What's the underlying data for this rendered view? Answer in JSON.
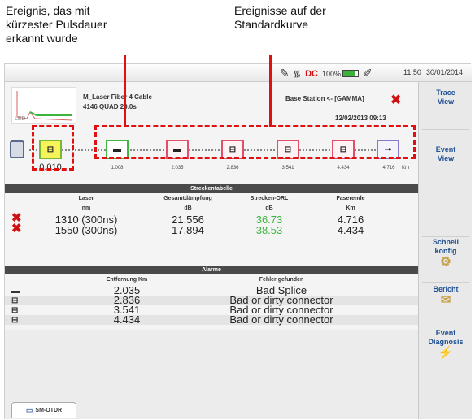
{
  "annotations": {
    "left": [
      "Ereignis, das mit",
      "kürzester Pulsdauer",
      "erkannt wurde"
    ],
    "right": [
      "Ereignisse auf der",
      "Standardkurve"
    ]
  },
  "statusbar": {
    "battery": "100%",
    "dc": "DC",
    "time": "11:50",
    "date": "30/01/2014"
  },
  "header": {
    "file_line": "M_Laser    Fiber 4  Cable",
    "sub_line": "4146 QUAD    20.0s",
    "base_station": "Base Station <- [GAMMA]",
    "date_line": "12/02/2013   09:13",
    "thumb_label": "LED"
  },
  "events": {
    "first_distance": "0.010",
    "distances": [
      "1.008",
      "2.035",
      "2.836",
      "3.541",
      "4.434",
      "4.716"
    ],
    "km_unit": "Km"
  },
  "summary_table": {
    "title": "Streckentabelle",
    "columns": [
      "Laser",
      "Gesamtdämpfung",
      "Strecken-ORL",
      "Faserende"
    ],
    "units": [
      "nm",
      "dB",
      "dB",
      "Km"
    ],
    "rows": [
      {
        "laser": "1310 (300ns)",
        "loss": "21.556",
        "orl": "36.73",
        "end": "4.716"
      },
      {
        "laser": "1550 (300ns)",
        "loss": "17.894",
        "orl": "38.53",
        "end": "4.434"
      }
    ]
  },
  "alarm_table": {
    "title": "Alarme",
    "columns": [
      "Entfernung Km",
      "Fehler gefunden"
    ],
    "rows": [
      {
        "distance": "2.035",
        "fault": "Bad Splice"
      },
      {
        "distance": "2.836",
        "fault": "Bad or dirty connector"
      },
      {
        "distance": "3.541",
        "fault": "Bad or dirty connector"
      },
      {
        "distance": "4.434",
        "fault": "Bad or dirty connector"
      }
    ]
  },
  "sidebar": {
    "trace_view": [
      "Trace",
      "View"
    ],
    "event_view": [
      "Event",
      "View"
    ],
    "quick_config": [
      "Schnell",
      "konfig"
    ],
    "report": "Bericht",
    "event_diag": [
      "Event",
      "Diagnosis"
    ]
  },
  "tab": {
    "label": "SM-OTDR"
  },
  "colors": {
    "annotation_red": "#e01010",
    "orl_green": "#3db53d",
    "sidebar_text": "#1e4f92"
  }
}
